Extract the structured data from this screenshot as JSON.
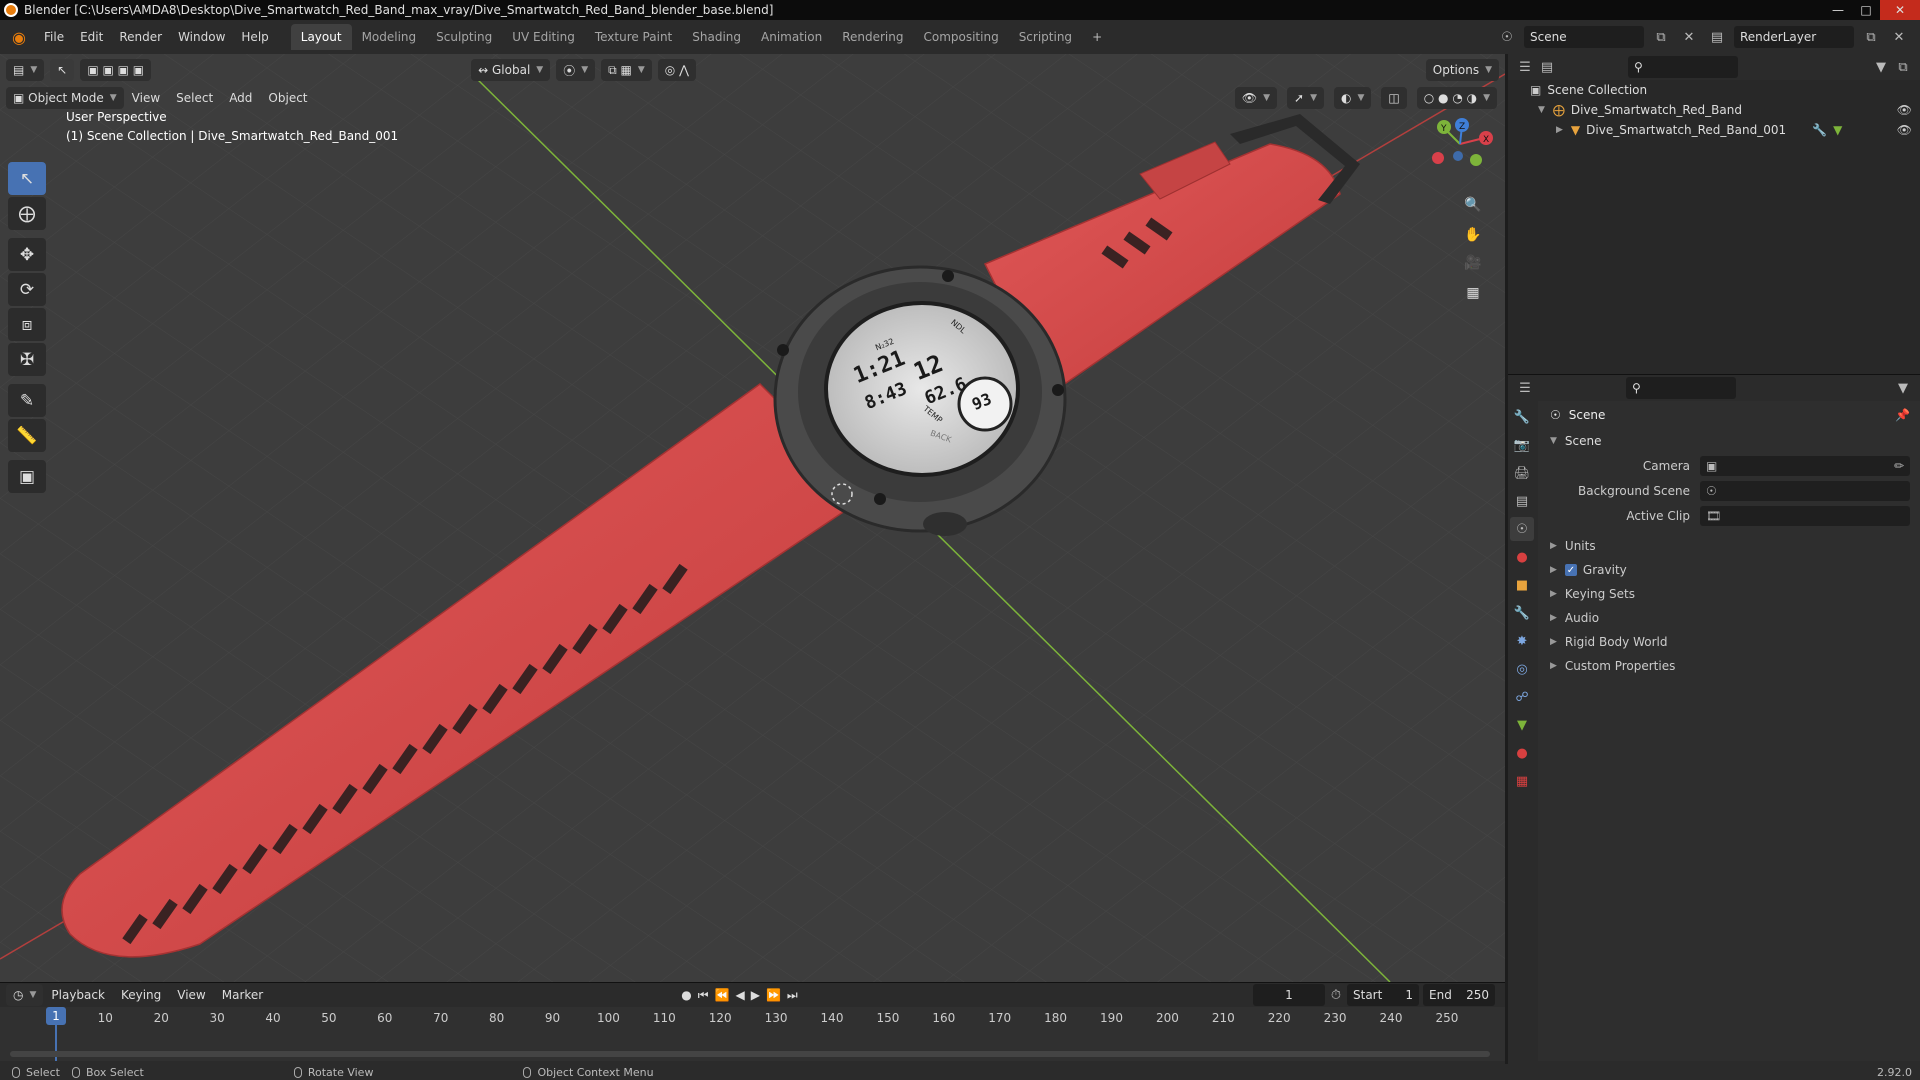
{
  "window": {
    "title": "Blender [C:\\Users\\AMDA8\\Desktop\\Dive_Smartwatch_Red_Band_max_vray/Dive_Smartwatch_Red_Band_blender_base.blend]"
  },
  "menubar": {
    "items": [
      "File",
      "Edit",
      "Render",
      "Window",
      "Help"
    ],
    "workspaces": [
      "Layout",
      "Modeling",
      "Sculpting",
      "UV Editing",
      "Texture Paint",
      "Shading",
      "Animation",
      "Rendering",
      "Compositing",
      "Scripting",
      "+"
    ],
    "active_workspace": "Layout",
    "scene": "Scene",
    "view_layer": "RenderLayer"
  },
  "viewport": {
    "transform_orientation": "Global",
    "options_label": "Options",
    "mode": "Object Mode",
    "menus": [
      "View",
      "Select",
      "Add",
      "Object"
    ],
    "overlay_line1": "User Perspective",
    "overlay_line2": "(1) Scene Collection | Dive_Smartwatch_Red_Band_001",
    "gizmo_axes": [
      "X",
      "Y",
      "Z"
    ],
    "watch_face": {
      "line1": "1:21",
      "line2": "12",
      "line3": "8:43",
      "line4": "62.6",
      "dial": "93",
      "sub1": "N₂32",
      "sub2": "TEMP",
      "sub3": "NDL",
      "bezel": "BACK"
    }
  },
  "timeline": {
    "menus": [
      "Playback",
      "Keying",
      "View",
      "Marker"
    ],
    "current_frame": "1",
    "start_label": "Start",
    "start": "1",
    "end_label": "End",
    "end": "250",
    "ticks": [
      "1",
      "10",
      "20",
      "30",
      "40",
      "50",
      "60",
      "70",
      "80",
      "90",
      "100",
      "110",
      "120",
      "130",
      "140",
      "150",
      "160",
      "170",
      "180",
      "190",
      "200",
      "210",
      "220",
      "230",
      "240",
      "250"
    ]
  },
  "statusbar": {
    "select": "Select",
    "box_select": "Box Select",
    "rotate_view": "Rotate View",
    "context_menu": "Object Context Menu",
    "version": "2.92.0"
  },
  "outliner": {
    "root": "Scene Collection",
    "items": [
      "Dive_Smartwatch_Red_Band",
      "Dive_Smartwatch_Red_Band_001"
    ]
  },
  "properties": {
    "context": "Scene",
    "section": "Scene",
    "fields": [
      {
        "label": "Camera",
        "value": ""
      },
      {
        "label": "Background Scene",
        "value": ""
      },
      {
        "label": "Active Clip",
        "value": ""
      }
    ],
    "panels": [
      "Units",
      "Gravity",
      "Keying Sets",
      "Audio",
      "Rigid Body World",
      "Custom Properties"
    ],
    "gravity_checked": true
  },
  "colors": {
    "accent": "#4772b3",
    "band_red": "#d94a4a",
    "axis_x": "#d8404a",
    "axis_y": "#7db43a",
    "axis_z": "#3f7fd8"
  }
}
